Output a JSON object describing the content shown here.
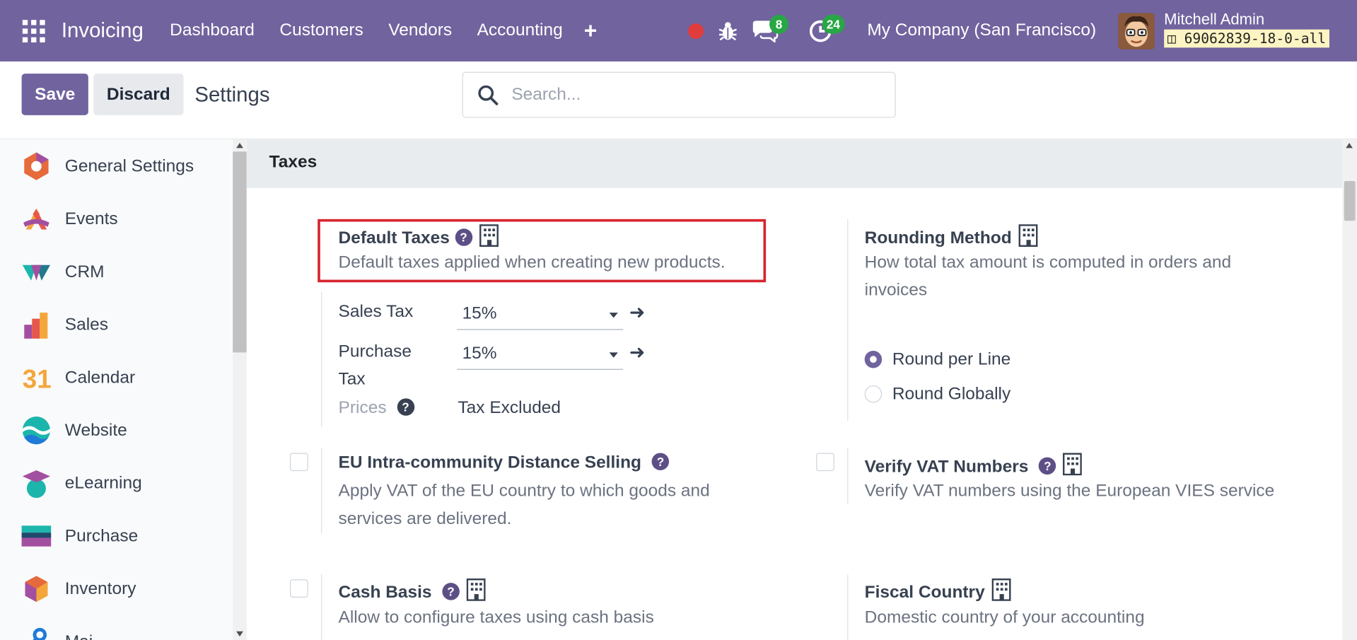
{
  "navbar": {
    "app_name": "Invoicing",
    "menu": [
      "Dashboard",
      "Customers",
      "Vendors",
      "Accounting"
    ],
    "plus": "+",
    "chat_badge": "8",
    "activity_badge": "24",
    "company": "My Company (San Francisco)",
    "user_name": "Mitchell Admin",
    "db_name": "69062839-18-0-all"
  },
  "control": {
    "save_label": "Save",
    "discard_label": "Discard",
    "title": "Settings",
    "search_placeholder": "Search..."
  },
  "sidebar": {
    "items": [
      {
        "label": "General Settings",
        "icon": "general-settings-icon"
      },
      {
        "label": "Events",
        "icon": "events-icon"
      },
      {
        "label": "CRM",
        "icon": "crm-icon"
      },
      {
        "label": "Sales",
        "icon": "sales-icon"
      },
      {
        "label": "Calendar",
        "icon": "calendar-icon"
      },
      {
        "label": "Website",
        "icon": "website-icon"
      },
      {
        "label": "eLearning",
        "icon": "elearning-icon"
      },
      {
        "label": "Purchase",
        "icon": "purchase-icon"
      },
      {
        "label": "Inventory",
        "icon": "inventory-icon"
      },
      {
        "label": "Mai...",
        "icon": "maintenance-icon"
      }
    ],
    "calendar_icon_text": "31"
  },
  "taxes": {
    "section_title": "Taxes",
    "default_taxes": {
      "title": "Default Taxes",
      "description": "Default taxes applied when creating new products.",
      "sales_tax_label": "Sales Tax",
      "sales_tax_value": "15%",
      "purchase_tax_label_1": "Purchase",
      "purchase_tax_label_2": "Tax",
      "purchase_tax_value": "15%",
      "prices_label": "Prices",
      "prices_value": "Tax Excluded"
    },
    "rounding": {
      "title": "Rounding Method",
      "description_1": "How total tax amount is computed in orders and",
      "description_2": "invoices",
      "options": [
        "Round per Line",
        "Round Globally"
      ],
      "selected": "Round per Line"
    },
    "eu_distance": {
      "title": "EU Intra-community Distance Selling",
      "description_1": "Apply VAT of the EU country to which goods and",
      "description_2": "services are delivered.",
      "checked": false
    },
    "verify_vat": {
      "title": "Verify VAT Numbers",
      "description": "Verify VAT numbers using the European VIES service",
      "checked": false
    },
    "cash_basis": {
      "title": "Cash Basis",
      "description": "Allow to configure taxes using cash basis",
      "checked": false
    },
    "fiscal_country": {
      "title": "Fiscal Country",
      "description": "Domestic country of your accounting"
    }
  },
  "colors": {
    "brand": "#71639e",
    "highlight": "#d7262e",
    "badge": "#28a745"
  }
}
